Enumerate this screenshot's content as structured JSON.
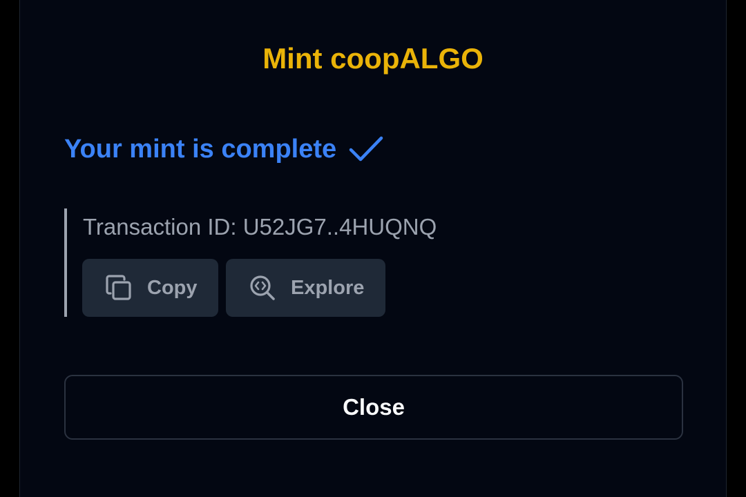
{
  "modal": {
    "title": "Mint coopALGO",
    "status_text": "Your mint is complete",
    "status_icon": "checkmark-icon",
    "transaction": {
      "label": "Transaction ID: U52JG7..4HUQNQ"
    },
    "buttons": {
      "copy_label": "Copy",
      "copy_icon": "copy-icon",
      "explore_label": "Explore",
      "explore_icon": "explore-search-icon"
    },
    "close_label": "Close"
  },
  "colors": {
    "background": "#000000",
    "modal_background": "#030712",
    "title": "#eab308",
    "status": "#3b82f6",
    "muted_text": "#9ca3af",
    "button_background": "#1f2937",
    "close_text": "#f9fafb"
  }
}
